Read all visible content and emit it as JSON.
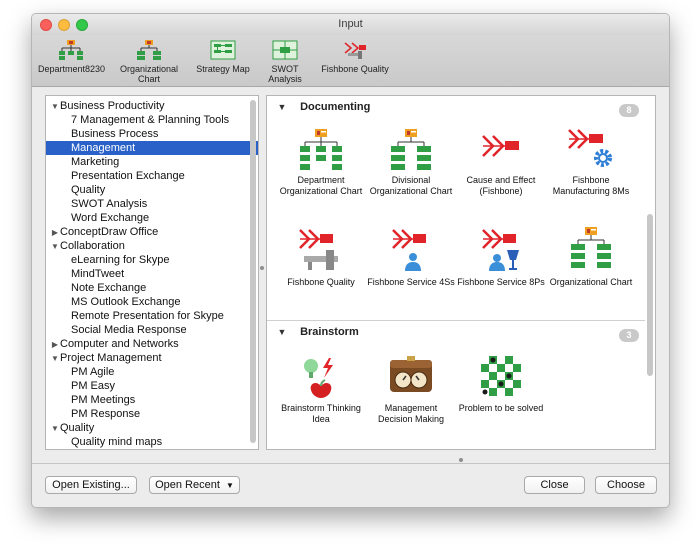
{
  "window": {
    "title": "Input"
  },
  "toolbar": {
    "items": [
      {
        "label": "Department8230",
        "icon": "org-chart-icon"
      },
      {
        "label": "Organizational Chart",
        "icon": "org-chart-icon"
      },
      {
        "label": "Strategy Map",
        "icon": "strategy-map-icon"
      },
      {
        "label": "SWOT Analysis",
        "icon": "swot-icon"
      },
      {
        "label": "Fishbone Quality",
        "icon": "fishbone-icon"
      }
    ]
  },
  "tree": {
    "items": [
      {
        "label": "Business Productivity",
        "level": 0,
        "expanded": true
      },
      {
        "label": "7 Management & Planning Tools",
        "level": 1
      },
      {
        "label": "Business Process",
        "level": 1
      },
      {
        "label": "Management",
        "level": 1,
        "selected": true
      },
      {
        "label": "Marketing",
        "level": 1
      },
      {
        "label": "Presentation Exchange",
        "level": 1
      },
      {
        "label": "Quality",
        "level": 1
      },
      {
        "label": "SWOT Analysis",
        "level": 1
      },
      {
        "label": "Word Exchange",
        "level": 1
      },
      {
        "label": "ConceptDraw Office",
        "level": 0,
        "expanded": false
      },
      {
        "label": "Collaboration",
        "level": 0,
        "expanded": true
      },
      {
        "label": "eLearning for Skype",
        "level": 1
      },
      {
        "label": "MindTweet",
        "level": 1
      },
      {
        "label": "Note Exchange",
        "level": 1
      },
      {
        "label": "MS Outlook Exchange",
        "level": 1
      },
      {
        "label": "Remote Presentation for Skype",
        "level": 1
      },
      {
        "label": "Social Media Response",
        "level": 1
      },
      {
        "label": "Computer and Networks",
        "level": 0,
        "expanded": false
      },
      {
        "label": "Project Management",
        "level": 0,
        "expanded": true
      },
      {
        "label": "PM Agile",
        "level": 1
      },
      {
        "label": "PM Easy",
        "level": 1
      },
      {
        "label": "PM Meetings",
        "level": 1
      },
      {
        "label": "PM Response",
        "level": 1
      },
      {
        "label": "Quality",
        "level": 0,
        "expanded": true
      },
      {
        "label": "Quality mind maps",
        "level": 1
      }
    ]
  },
  "sections": {
    "documenting": {
      "title": "Documenting",
      "count": "8",
      "tiles": [
        {
          "label": "Department Organizational Chart",
          "icon": "org-chart-icon"
        },
        {
          "label": "Divisional Organizational Chart",
          "icon": "org-chart-icon"
        },
        {
          "label": "Cause and Effect (Fishbone)",
          "icon": "fishbone-icon"
        },
        {
          "label": "Fishbone Manufacturing 8Ms",
          "icon": "fishbone-gear-icon"
        },
        {
          "label": "Fishbone Quality",
          "icon": "fishbone-caliper-icon"
        },
        {
          "label": "Fishbone Service 4Ss",
          "icon": "fishbone-person-icon"
        },
        {
          "label": "Fishbone Service 8Ps",
          "icon": "fishbone-glass-icon"
        },
        {
          "label": "Organizational Chart",
          "icon": "org-chart-icon"
        }
      ]
    },
    "brainstorm": {
      "title": "Brainstorm",
      "count": "3",
      "tiles": [
        {
          "label": "Brainstorm Thinking Idea",
          "icon": "brainstorm-icon"
        },
        {
          "label": "Management Decision Making",
          "icon": "scale-clock-icon"
        },
        {
          "label": "Problem to be solved",
          "icon": "chessboard-icon"
        }
      ]
    }
  },
  "footer": {
    "open_existing": "Open Existing...",
    "open_recent": "Open Recent",
    "open_recent_arrow": "▼",
    "close": "Close",
    "choose": "Choose"
  },
  "colors": {
    "selection": "#2a61c8",
    "org_green": "#2f9e44",
    "org_orange": "#f0a020",
    "fish_red": "#e0242a"
  }
}
